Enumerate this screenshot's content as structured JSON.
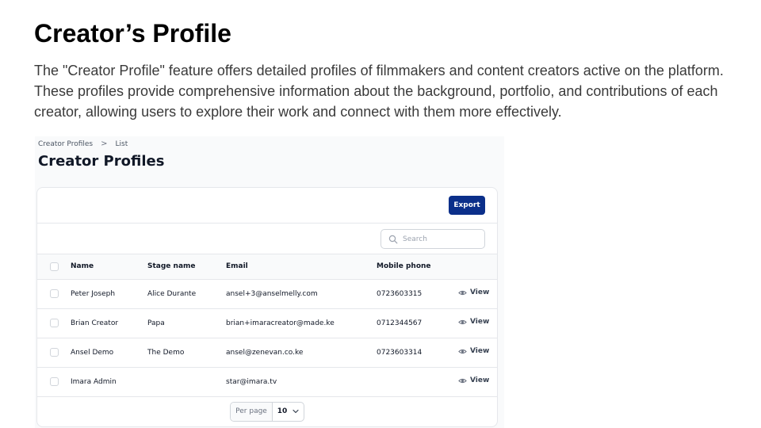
{
  "slide": {
    "title": "Creator’s Profile",
    "description": "The \"Creator Profile\" feature offers detailed profiles of filmmakers and content creators active on the platform. These profiles provide comprehensive information about the background, portfolio, and contributions of each creator, allowing users to explore their work and connect with them more effectively."
  },
  "app": {
    "breadcrumb": [
      "Creator Profiles",
      "List"
    ],
    "page_title": "Creator Profiles",
    "export_label": "Export",
    "search": {
      "placeholder": "Search",
      "value": ""
    },
    "table": {
      "columns": [
        "Name",
        "Stage name",
        "Email",
        "Mobile phone"
      ],
      "rows": [
        {
          "name": "Peter Joseph",
          "stage_name": "Alice Durante",
          "email": "ansel+3@anselmelly.com",
          "phone": "0723603315",
          "action": "View"
        },
        {
          "name": "Brian Creator",
          "stage_name": "Papa",
          "email": "brian+imaracreator@made.ke",
          "phone": "0712344567",
          "action": "View"
        },
        {
          "name": "Ansel Demo",
          "stage_name": "The Demo",
          "email": "ansel@zenevan.co.ke",
          "phone": "0723603314",
          "action": "View"
        },
        {
          "name": "Imara Admin",
          "stage_name": "",
          "email": "star@imara.tv",
          "phone": "",
          "action": "View"
        }
      ]
    },
    "pagination": {
      "per_page_label": "Per page",
      "per_page_value": "10"
    }
  },
  "icons": {
    "breadcrumb_separator": "chevron-right-icon",
    "search": "search-icon",
    "view": "eye-icon",
    "select": "chevron-down-icon"
  },
  "colors": {
    "export_button": "#0b2f8a",
    "border": "#e5e7eb",
    "muted_text": "#6b7280"
  }
}
